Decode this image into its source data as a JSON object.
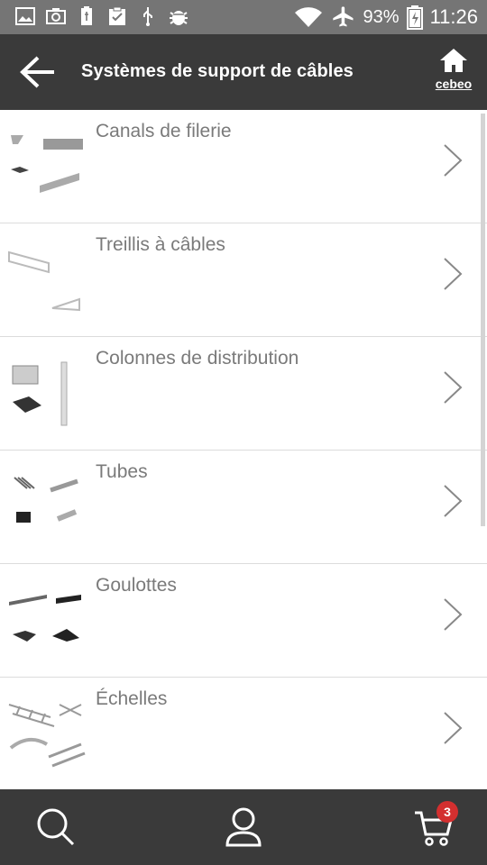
{
  "status_bar": {
    "battery": "93%",
    "time": "11:26",
    "icons": [
      "image-icon",
      "camera-icon",
      "usb-battery-icon",
      "clipboard-check-icon",
      "usb-icon",
      "android-debug-icon",
      "wifi-icon",
      "airplane-mode-icon",
      "battery-charging-icon"
    ]
  },
  "app_bar": {
    "title": "Systèmes de support de câbles",
    "home_label": "cebeo"
  },
  "categories": [
    {
      "label": "Canals de filerie"
    },
    {
      "label": "Treillis à câbles"
    },
    {
      "label": "Colonnes de distribution"
    },
    {
      "label": "Tubes"
    },
    {
      "label": "Goulottes"
    },
    {
      "label": "Échelles"
    }
  ],
  "bottom_nav": {
    "cart_count": "3"
  },
  "colors": {
    "status_bar": "#757575",
    "app_bar": "#3a3a3a",
    "badge": "#d32f2f",
    "label": "#7a7a7a"
  }
}
